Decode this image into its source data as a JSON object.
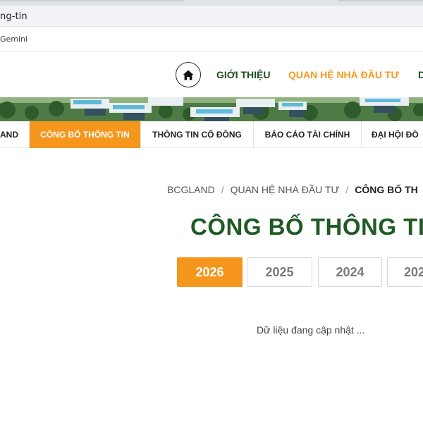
{
  "browser": {
    "address_text": "ng-tin",
    "bookmark_label": "Gemini"
  },
  "header": {
    "home_icon": "home-icon",
    "nav": [
      {
        "label": "GIỚI THIỆU"
      },
      {
        "label": "QUAN HỆ NHÀ ĐẦU TƯ"
      },
      {
        "label": "D"
      }
    ]
  },
  "subnav": {
    "items": [
      {
        "label": "AND"
      },
      {
        "label": "CÔNG BỐ THÔNG TIN"
      },
      {
        "label": "THÔNG TIN CỔ ĐÔNG"
      },
      {
        "label": "BÁO CÁO TÀI CHÍNH"
      },
      {
        "label": "ĐẠI HỘI ĐỒ"
      }
    ]
  },
  "breadcrumb": {
    "items": [
      "BCGLAND",
      "QUAN HỆ NHÀ ĐẦU TƯ"
    ],
    "current": "CÔNG BỐ TH",
    "separator": "/"
  },
  "page": {
    "title": "CÔNG BỐ THÔNG TI",
    "empty_message": "Dữ liệu đang cập nhật ..."
  },
  "years": [
    {
      "label": "2026",
      "active": true
    },
    {
      "label": "2025",
      "active": false
    },
    {
      "label": "2024",
      "active": false
    },
    {
      "label": "202",
      "active": false
    }
  ],
  "colors": {
    "accent_orange": "#f5961d",
    "brand_green": "#1f5a23"
  }
}
